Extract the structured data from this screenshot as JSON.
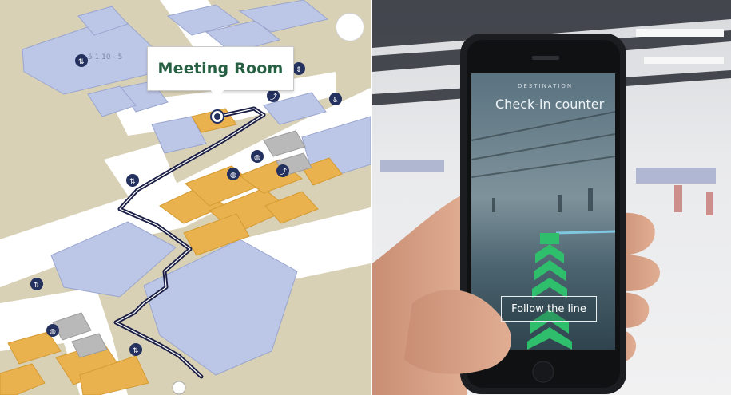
{
  "map": {
    "callout_title": "Meeting Room",
    "room_code_label": "5 1 10 - 5",
    "colors": {
      "background": "#d9d1b6",
      "room_blue": "#bcc6e6",
      "room_orange": "#e9b24e",
      "corridor": "#ffffff",
      "route": "#1b1f45",
      "marker": "#24305e",
      "callout_text": "#275f43"
    },
    "icons": [
      "compass-icon",
      "elevator-icon",
      "restroom-icon",
      "stairs-icon",
      "escalator-icon",
      "location-pin-icon"
    ]
  },
  "ar_view": {
    "small_header": "DESTINATION",
    "destination_title": "Check-in counter",
    "instruction_button": "Follow the line",
    "colors": {
      "guide_arrow": "#2fbf6c",
      "screen_bg": "#4c6470"
    }
  }
}
